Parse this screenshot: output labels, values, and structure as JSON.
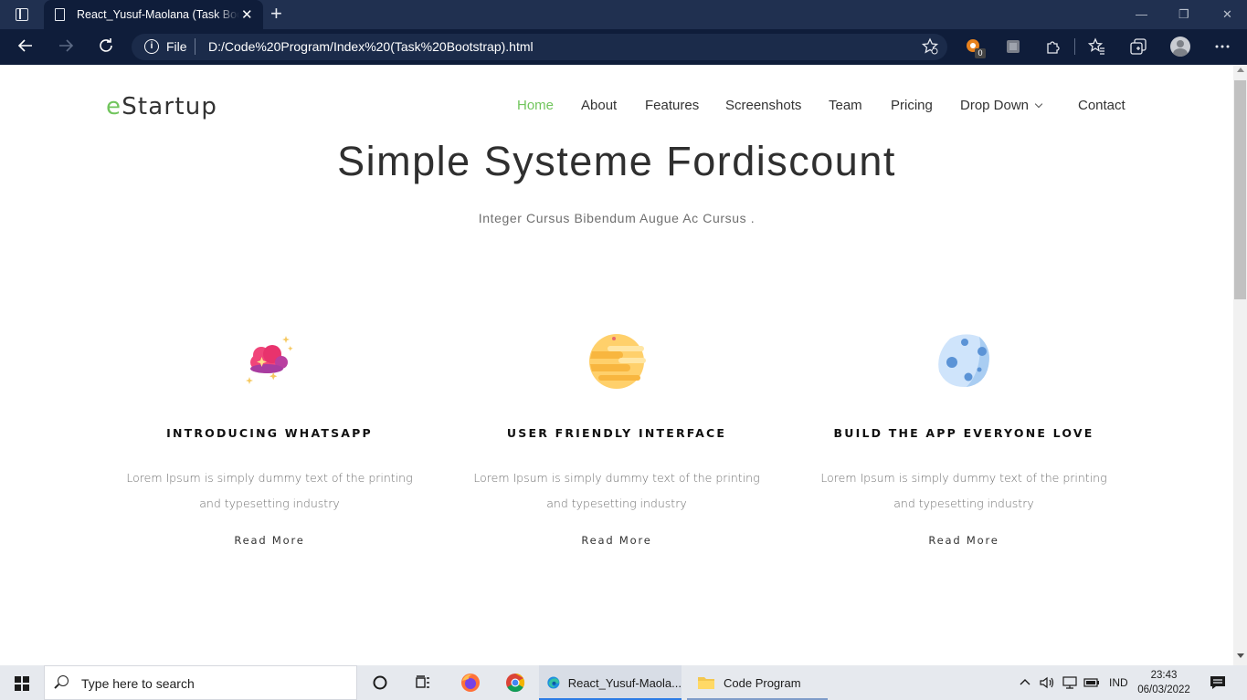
{
  "browser": {
    "tab_title": "React_Yusuf-Maolana (Task Bootstrap)",
    "tab_close": "✕",
    "new_tab": "+",
    "window_controls": {
      "minimize": "—",
      "restore": "❐",
      "close": "✕"
    },
    "address": {
      "scheme_label": "File",
      "url": "D:/Code%20Program/Index%20(Task%20Bootstrap).html"
    },
    "extension_badge": "0"
  },
  "site": {
    "logo_accent": "e",
    "logo_rest": "Startup",
    "nav": [
      "Home",
      "About",
      "Features",
      "Screenshots",
      "Team",
      "Pricing",
      "Drop Down",
      "Contact"
    ],
    "hero_title": "Simple Systeme Fordiscount",
    "hero_subtitle": "Integer Cursus Bibendum Augue Ac Cursus .",
    "features": [
      {
        "icon": "pink-cloud-icon",
        "title": "INTRODUCING WHATSAPP",
        "text": "Lorem Ipsum is simply dummy text of the printing and typesetting industry",
        "link": "Read More"
      },
      {
        "icon": "yellow-planet-icon",
        "title": "USER FRIENDLY INTERFACE",
        "text": "Lorem Ipsum is simply dummy text of the printing and typesetting industry",
        "link": "Read More"
      },
      {
        "icon": "blue-moon-icon",
        "title": "BUILD THE APP EVERYONE LOVE",
        "text": "Lorem Ipsum is simply dummy text of the printing and typesetting industry",
        "link": "Read More"
      }
    ],
    "colors": {
      "accent": "#71c55d",
      "heading": "#111111",
      "body_text": "#6f6f6f"
    }
  },
  "taskbar": {
    "search_placeholder": "Type here to search",
    "apps": [
      {
        "icon": "cortana-icon",
        "label": ""
      },
      {
        "icon": "task-view-icon",
        "label": ""
      },
      {
        "icon": "firefox-icon",
        "label": ""
      },
      {
        "icon": "chrome-icon",
        "label": ""
      },
      {
        "icon": "edge-icon",
        "label": "React_Yusuf-Maola..."
      },
      {
        "icon": "folder-icon",
        "label": "Code Program"
      }
    ],
    "language": "IND",
    "time": "23:43",
    "date": "06/03/2022"
  }
}
